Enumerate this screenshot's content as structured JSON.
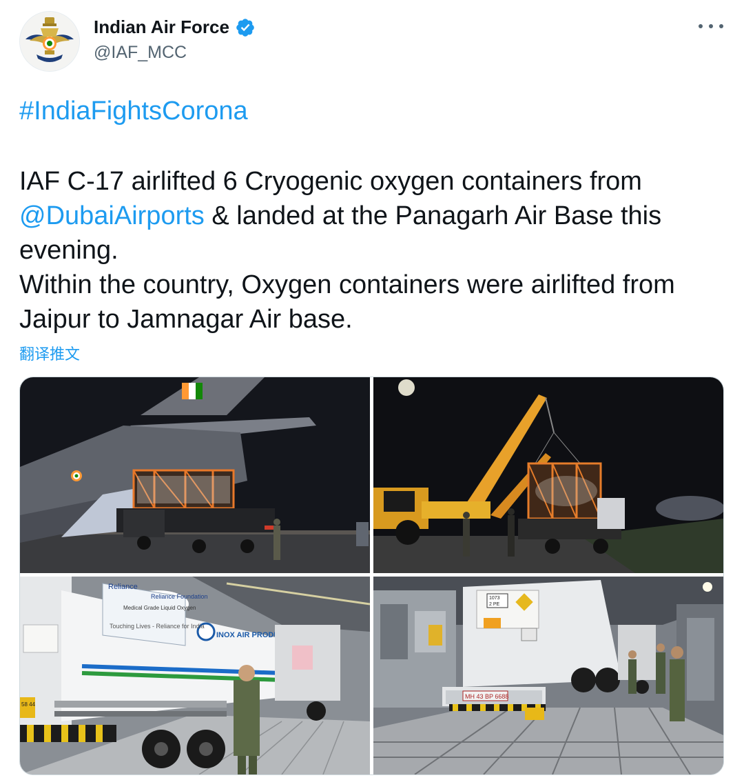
{
  "tweet": {
    "author": {
      "display_name": "Indian Air Force",
      "handle": "@IAF_MCC",
      "verified": true,
      "avatar_icon": "iaf-emblem-icon"
    },
    "more_icon": "more-options-icon",
    "hashtag": "#IndiaFightsCorona",
    "body": {
      "part1": "IAF C-17 airlifted 6 Cryogenic oxygen containers from ",
      "mention": "@DubaiAirports",
      "part2": " & landed at the Panagarh Air Base this evening.",
      "part3": "Within the country, Oxygen containers were airlifted from Jaipur to Jamnagar Air base."
    },
    "translate_label": "翻译推文",
    "media": {
      "count": 4,
      "photo3_texts": {
        "brand": "Reliance",
        "foundation": "Reliance Foundation",
        "cargo": "Medical Grade Liquid Oxygen",
        "slogan": "Touching Lives - Reliance for India",
        "inox": "INOX AIR PRODUCTS",
        "plate": "58 44"
      },
      "photo4_texts": {
        "hazard_code": "1073",
        "hazard_class": "2 PE",
        "rear_plate": "MH 43 BP 6688"
      }
    }
  },
  "colors": {
    "link": "#1d9bf0",
    "text": "#0f1419",
    "secondary": "#536471",
    "border": "#cfd9de"
  }
}
